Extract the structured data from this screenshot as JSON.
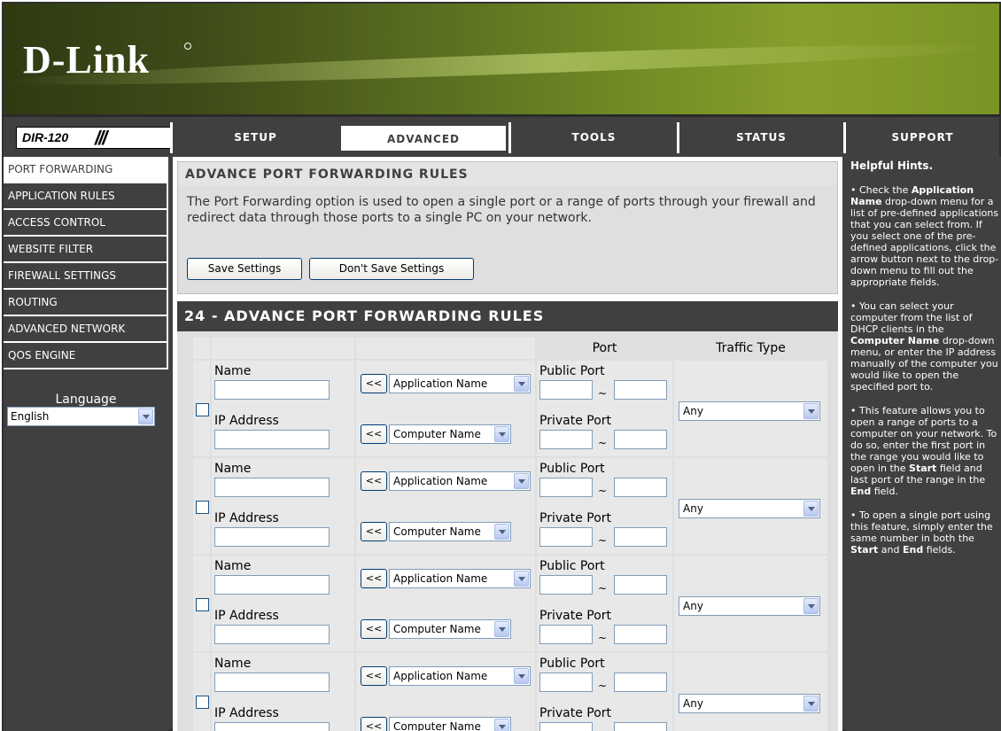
{
  "brand": "D-Link",
  "model": "DIR-120",
  "tabs": [
    {
      "label": "SETUP"
    },
    {
      "label": "ADVANCED"
    },
    {
      "label": "TOOLS"
    },
    {
      "label": "STATUS"
    },
    {
      "label": "SUPPORT"
    }
  ],
  "sidebar": {
    "items": [
      {
        "label": "PORT FORWARDING"
      },
      {
        "label": "APPLICATION RULES"
      },
      {
        "label": "ACCESS CONTROL"
      },
      {
        "label": "WEBSITE FILTER"
      },
      {
        "label": "FIREWALL SETTINGS"
      },
      {
        "label": "ROUTING"
      },
      {
        "label": "ADVANCED NETWORK"
      },
      {
        "label": "QOS ENGINE"
      }
    ],
    "language_label": "Language",
    "language_value": "English"
  },
  "main": {
    "title": "ADVANCE PORT FORWARDING RULES",
    "description": "The Port Forwarding option is used to open a single port or a range of ports through your firewall and redirect data through those ports to a single PC on your network.",
    "save_label": "Save Settings",
    "dont_save_label": "Don't Save Settings",
    "rules_title": "24 - ADVANCE PORT FORWARDING RULES",
    "col_port": "Port",
    "col_traffic": "Traffic Type",
    "rules": [
      {
        "name_label": "Name",
        "ip_label": "IP Address",
        "app_select": "Application Name",
        "computer_select": "Computer Name",
        "public_label": "Public Port",
        "private_label": "Private Port",
        "traffic": "Any",
        "arrow": "<<",
        "tilde": "~"
      },
      {
        "name_label": "Name",
        "ip_label": "IP Address",
        "app_select": "Application Name",
        "computer_select": "Computer Name",
        "public_label": "Public Port",
        "private_label": "Private Port",
        "traffic": "Any",
        "arrow": "<<",
        "tilde": "~"
      },
      {
        "name_label": "Name",
        "ip_label": "IP Address",
        "app_select": "Application Name",
        "computer_select": "Computer Name",
        "public_label": "Public Port",
        "private_label": "Private Port",
        "traffic": "Any",
        "arrow": "<<",
        "tilde": "~"
      },
      {
        "name_label": "Name",
        "ip_label": "IP Address",
        "app_select": "Application Name",
        "computer_select": "Computer Name",
        "public_label": "Public Port",
        "private_label": "Private Port",
        "traffic": "Any",
        "arrow": "<<",
        "tilde": "~"
      }
    ]
  },
  "hints": {
    "title": "Helpful Hints.",
    "hint1_pre": "• Check the ",
    "hint1_bold": "Application Name",
    "hint1_post": " drop-down menu for a list of pre-defined applications that you can select from. If you select one of the pre-defined applications, click the arrow button next to the drop-down menu to fill out the appropriate fields.",
    "hint2_pre": "• You can select your computer from the list of DHCP clients in the ",
    "hint2_bold": "Computer Name",
    "hint2_post": " drop-down menu, or enter the IP address manually of the computer you would like to open the specified port to.",
    "hint3_pre": "• This feature allows you to open a range of ports to a computer on your network. To do so, enter the first port in the range you would like to open in the ",
    "hint3_bold1": "Start",
    "hint3_mid": " field and last port of the range in the ",
    "hint3_bold2": "End",
    "hint3_post": " field.",
    "hint4_pre": "• To open a single port using this feature, simply enter the same number in both the ",
    "hint4_bold1": "Start",
    "hint4_mid": " and ",
    "hint4_bold2": "End",
    "hint4_post": " fields."
  }
}
